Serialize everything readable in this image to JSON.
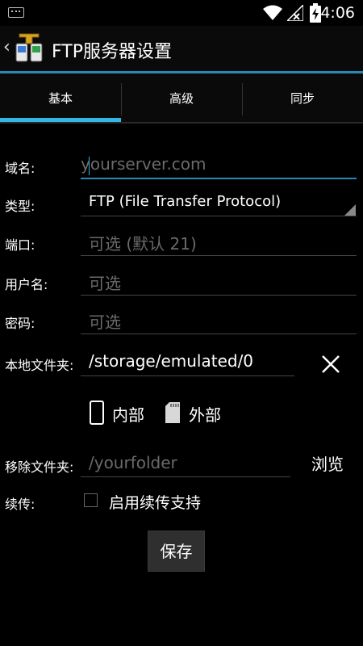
{
  "status_bar": {
    "time": "4:06"
  },
  "action_bar": {
    "title": "FTP服务器设置"
  },
  "tabs": [
    {
      "label": "基本",
      "selected": true
    },
    {
      "label": "高级",
      "selected": false
    },
    {
      "label": "同步",
      "selected": false
    }
  ],
  "form": {
    "domain": {
      "label": "域名:",
      "placeholder": "yourserver.com"
    },
    "type": {
      "label": "类型:",
      "value": "FTP (File Transfer Protocol)"
    },
    "port": {
      "label": "端口:",
      "placeholder": "可选 (默认 21)"
    },
    "username": {
      "label": "用户名:",
      "placeholder": "可选"
    },
    "password": {
      "label": "密码:",
      "placeholder": "可选"
    },
    "local_folder": {
      "label": "本地文件夹:",
      "value": "/storage/emulated/0"
    },
    "storage_options": {
      "internal": "内部",
      "external": "外部"
    },
    "remote_folder": {
      "label": "移除文件夹:",
      "placeholder": "/yourfolder",
      "browse": "浏览"
    },
    "resume": {
      "label": "续传:",
      "checkbox_label": "启用续传支持",
      "checked": false
    }
  },
  "save_button": "保存",
  "colors": {
    "accent": "#33b5e5",
    "background": "#000000"
  }
}
